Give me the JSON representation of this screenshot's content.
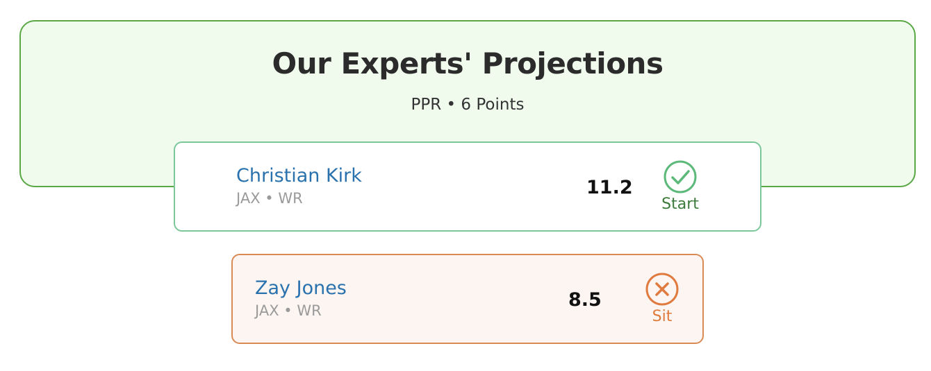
{
  "header": {
    "title": "Our Experts' Projections",
    "subtitle": "PPR • 6 Points"
  },
  "players": [
    {
      "name": "Christian Kirk",
      "meta": "JAX • WR",
      "points": "11.2",
      "verdict": "Start",
      "verdict_icon": "check-circle-icon",
      "accent_color": "#5cb97a"
    },
    {
      "name": "Zay Jones",
      "meta": "JAX • WR",
      "points": "8.5",
      "verdict": "Sit",
      "verdict_icon": "x-circle-icon",
      "accent_color": "#e07b3f"
    }
  ],
  "colors": {
    "panel_border": "#5aa845",
    "panel_background": "#f0fbee",
    "player_name": "#2a72ad",
    "start_text": "#3b7a3b",
    "sit_text": "#de7a3c"
  }
}
